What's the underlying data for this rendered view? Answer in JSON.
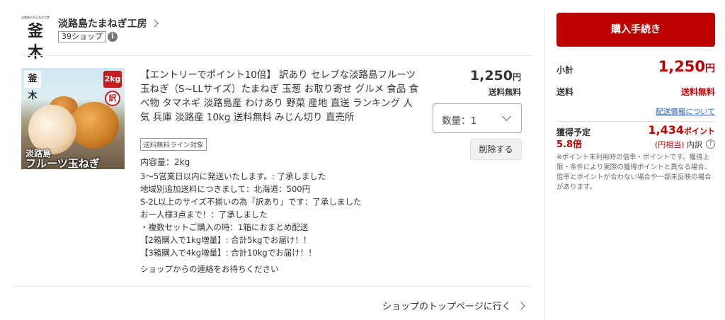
{
  "shop": {
    "logo_small_text": "淡路島のお玉ねぎ工房",
    "logo_mark": "釜木",
    "name": "淡路島たまねぎ工房",
    "badge": "39ショップ",
    "info_icon": "i"
  },
  "product": {
    "image": {
      "logo_mark": "釜木",
      "badge_weight": "2kg",
      "badge_wake": "訳",
      "caption_line1": "淡路島",
      "caption_line2": "フルーツ玉ねぎ"
    },
    "title": "【エントリーでポイント10倍】 訳あり セレブな淡路島フルーツ玉ねぎ（S~LLサイズ）たまねぎ 玉葱 お取り寄せ グルメ 食品 食べ物 タマネギ 淡路島産 わけあり 野菜 産地 直送 ランキング 人気 兵庫 淡路産 10kg 送料無料 みじん切り 直売所",
    "tag": "送料無料ライン対象",
    "capacity": "内容量：2kg",
    "options": [
      "3〜5営業日以内に発送いたします。: 了承しました",
      "地域別追加送料につきまして：北海道：500円",
      "S-2L以上のサイズ不揃いの為「訳あり」です：了承しました",
      "お一人様3点まで！：了承しました",
      "・複数セットご購入の時：1箱におまとめ配送",
      "【2箱購入で1kg増量】: 合計5kgでお届け！！",
      "【3箱購入で4kg増量】: 合計10kgでお届け！！"
    ],
    "shop_message": "ショップからの連絡をお待ちください",
    "price": "1,250",
    "price_unit": "円",
    "shipping": "送料無料",
    "quantity_label": "数量：1",
    "delete_label": "削除する"
  },
  "footer_link": "ショップのトップページに行く",
  "summary": {
    "checkout_label": "購入手続き",
    "subtotal_label": "小計",
    "subtotal_value": "1,250",
    "subtotal_unit": "円",
    "shipping_label": "送料",
    "shipping_value": "送料無料",
    "shipping_info_link": "配送情報について",
    "points_label": "獲得予定",
    "points_rate": "5.8倍",
    "points_value": "1,434",
    "points_unit": "ポイント",
    "points_equiv_prefix": "(円相当)",
    "points_equiv_suffix": "内訳",
    "points_help_icon": "?",
    "points_note": "※ポイント未利用時の倍率・ポイントです。獲得上限・条件により実際の獲得ポイントと異なる場合、倍率とポイントが合わない場合や一部未反映の場合があります。"
  },
  "colors": {
    "accent": "#bf0000",
    "link": "#1a63b8"
  }
}
